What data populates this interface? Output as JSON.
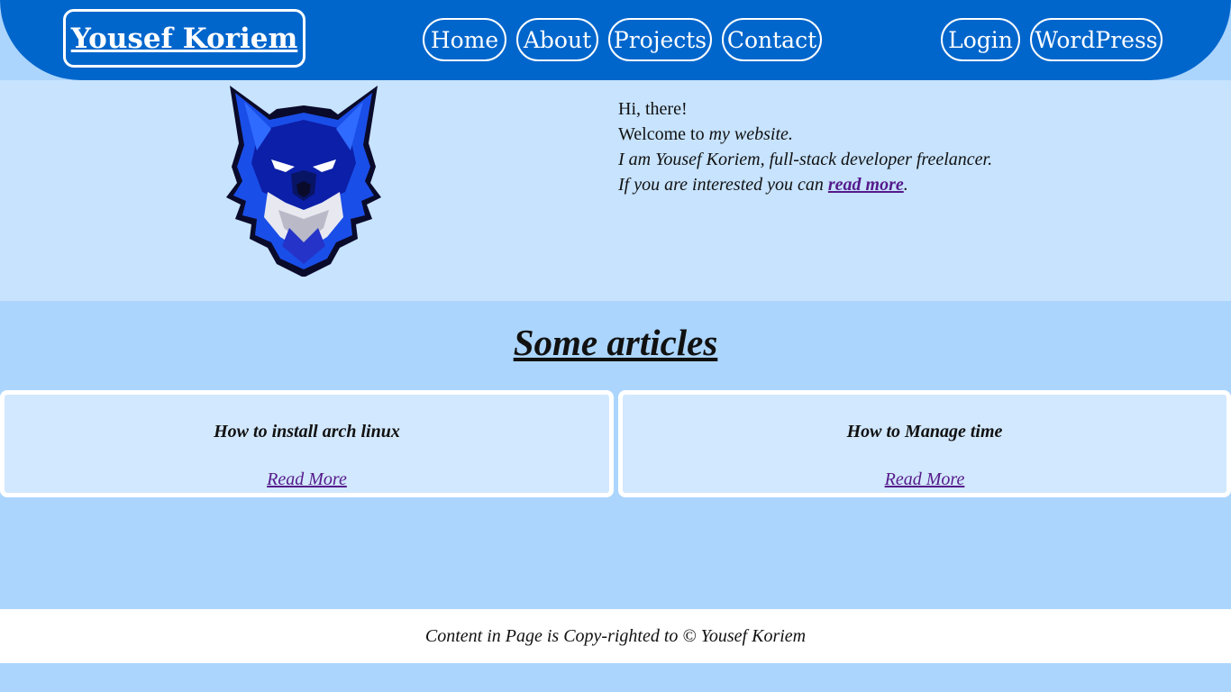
{
  "header": {
    "brand": "Yousef Koriem",
    "nav": [
      "Home",
      "About",
      "Projects",
      "Contact"
    ],
    "auth": [
      "Login",
      "WordPress"
    ]
  },
  "hero": {
    "line1": "Hi, there!",
    "line2_prefix": "Welcome to ",
    "line2_em": "my website",
    "line2_suffix": ".",
    "line3": "I am Yousef Koriem, full-stack developer freelancer.",
    "line4_prefix": "If you are interested you can ",
    "line4_link": "read more",
    "line4_suffix": "."
  },
  "articles": {
    "title": "Some articles",
    "items": [
      {
        "title": "How to install arch linux",
        "link": "Read More"
      },
      {
        "title": "How to Manage time",
        "link": "Read More"
      }
    ]
  },
  "footer": {
    "text": "Content in Page is Copy-righted to © Yousef Koriem"
  },
  "colors": {
    "header": "#0066cc",
    "hero_bg": "#c7e3fe",
    "page_bg": "#abd5fd",
    "card_bg": "#d2e8fe",
    "link": "#551a8b"
  },
  "icons": {
    "logo": "wolf-mascot-logo"
  }
}
